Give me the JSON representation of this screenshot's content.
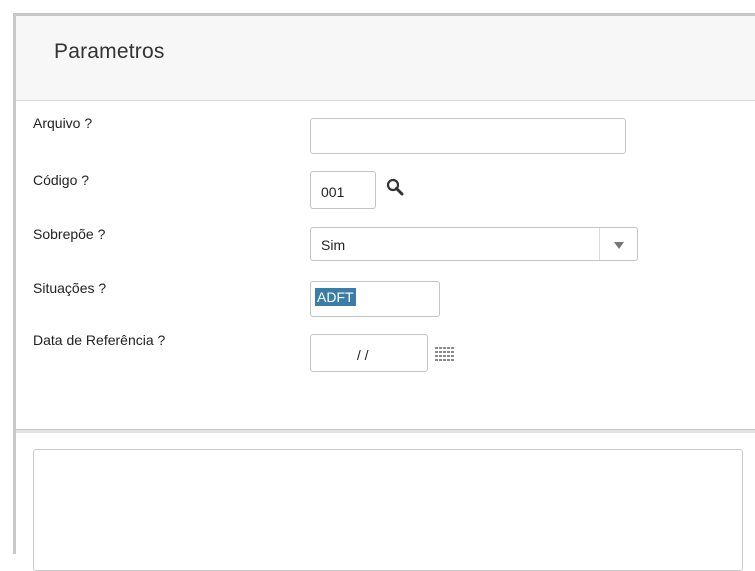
{
  "dialog": {
    "title": "Parametros"
  },
  "fields": {
    "arquivo": {
      "label": "Arquivo ?",
      "value": ""
    },
    "codigo": {
      "label": "Código ?",
      "value": "001"
    },
    "sobrepoe": {
      "label": "Sobrepõe ?",
      "value": "Sim"
    },
    "situacoes": {
      "label": "Situações ?",
      "value": "ADFT"
    },
    "data_referencia": {
      "label": "Data de Referência ?",
      "value": " / /"
    }
  },
  "icons": {
    "search": "search-icon",
    "calendar": "calendar-icon",
    "dropdown": "chevron-down-icon"
  },
  "colors": {
    "selection": "#3a7ea8",
    "frame": "#c8c8c8"
  }
}
